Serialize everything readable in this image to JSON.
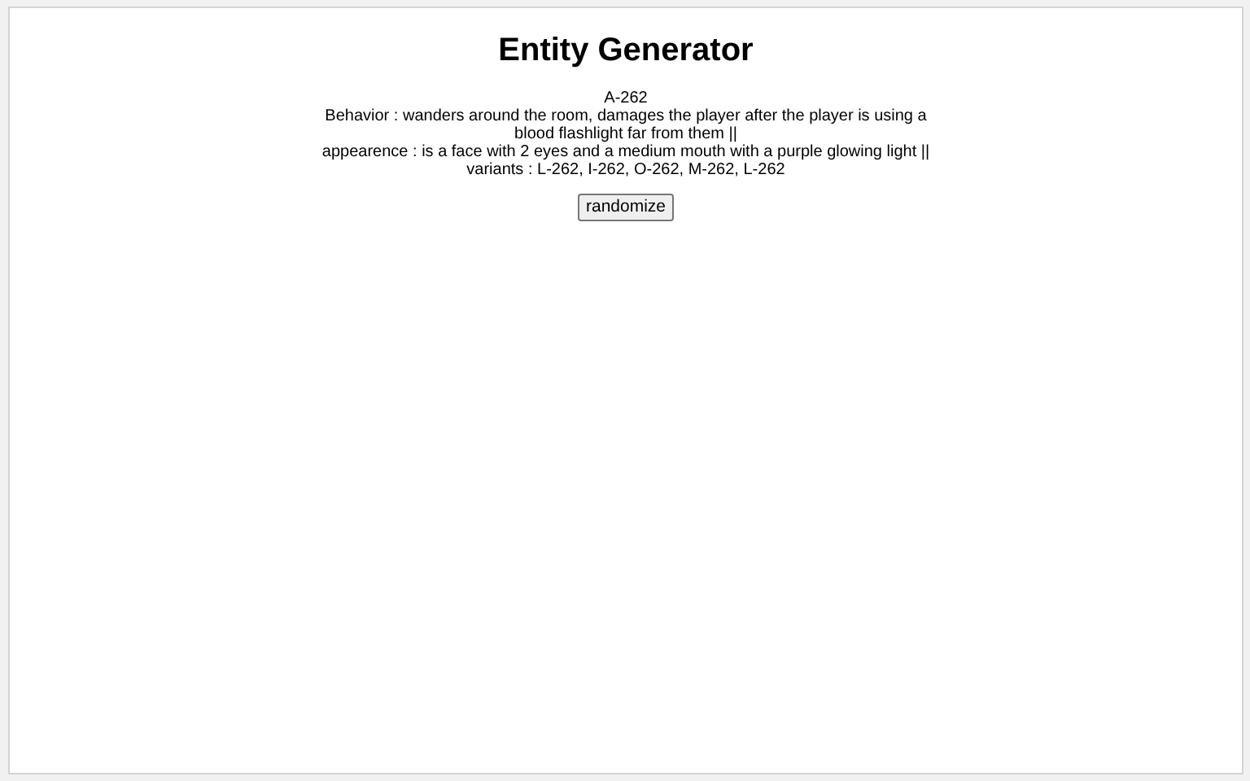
{
  "title": "Entity Generator",
  "entity": {
    "name": "A-262",
    "behavior": "Behavior : wanders around the room, damages the player after the player is using a blood flashlight far from them ||",
    "appearance": "appearence : is a face with 2 eyes and a medium mouth with a purple glowing light ||",
    "variants": "variants : L-262, I-262, O-262, M-262, L-262"
  },
  "button": "randomize"
}
